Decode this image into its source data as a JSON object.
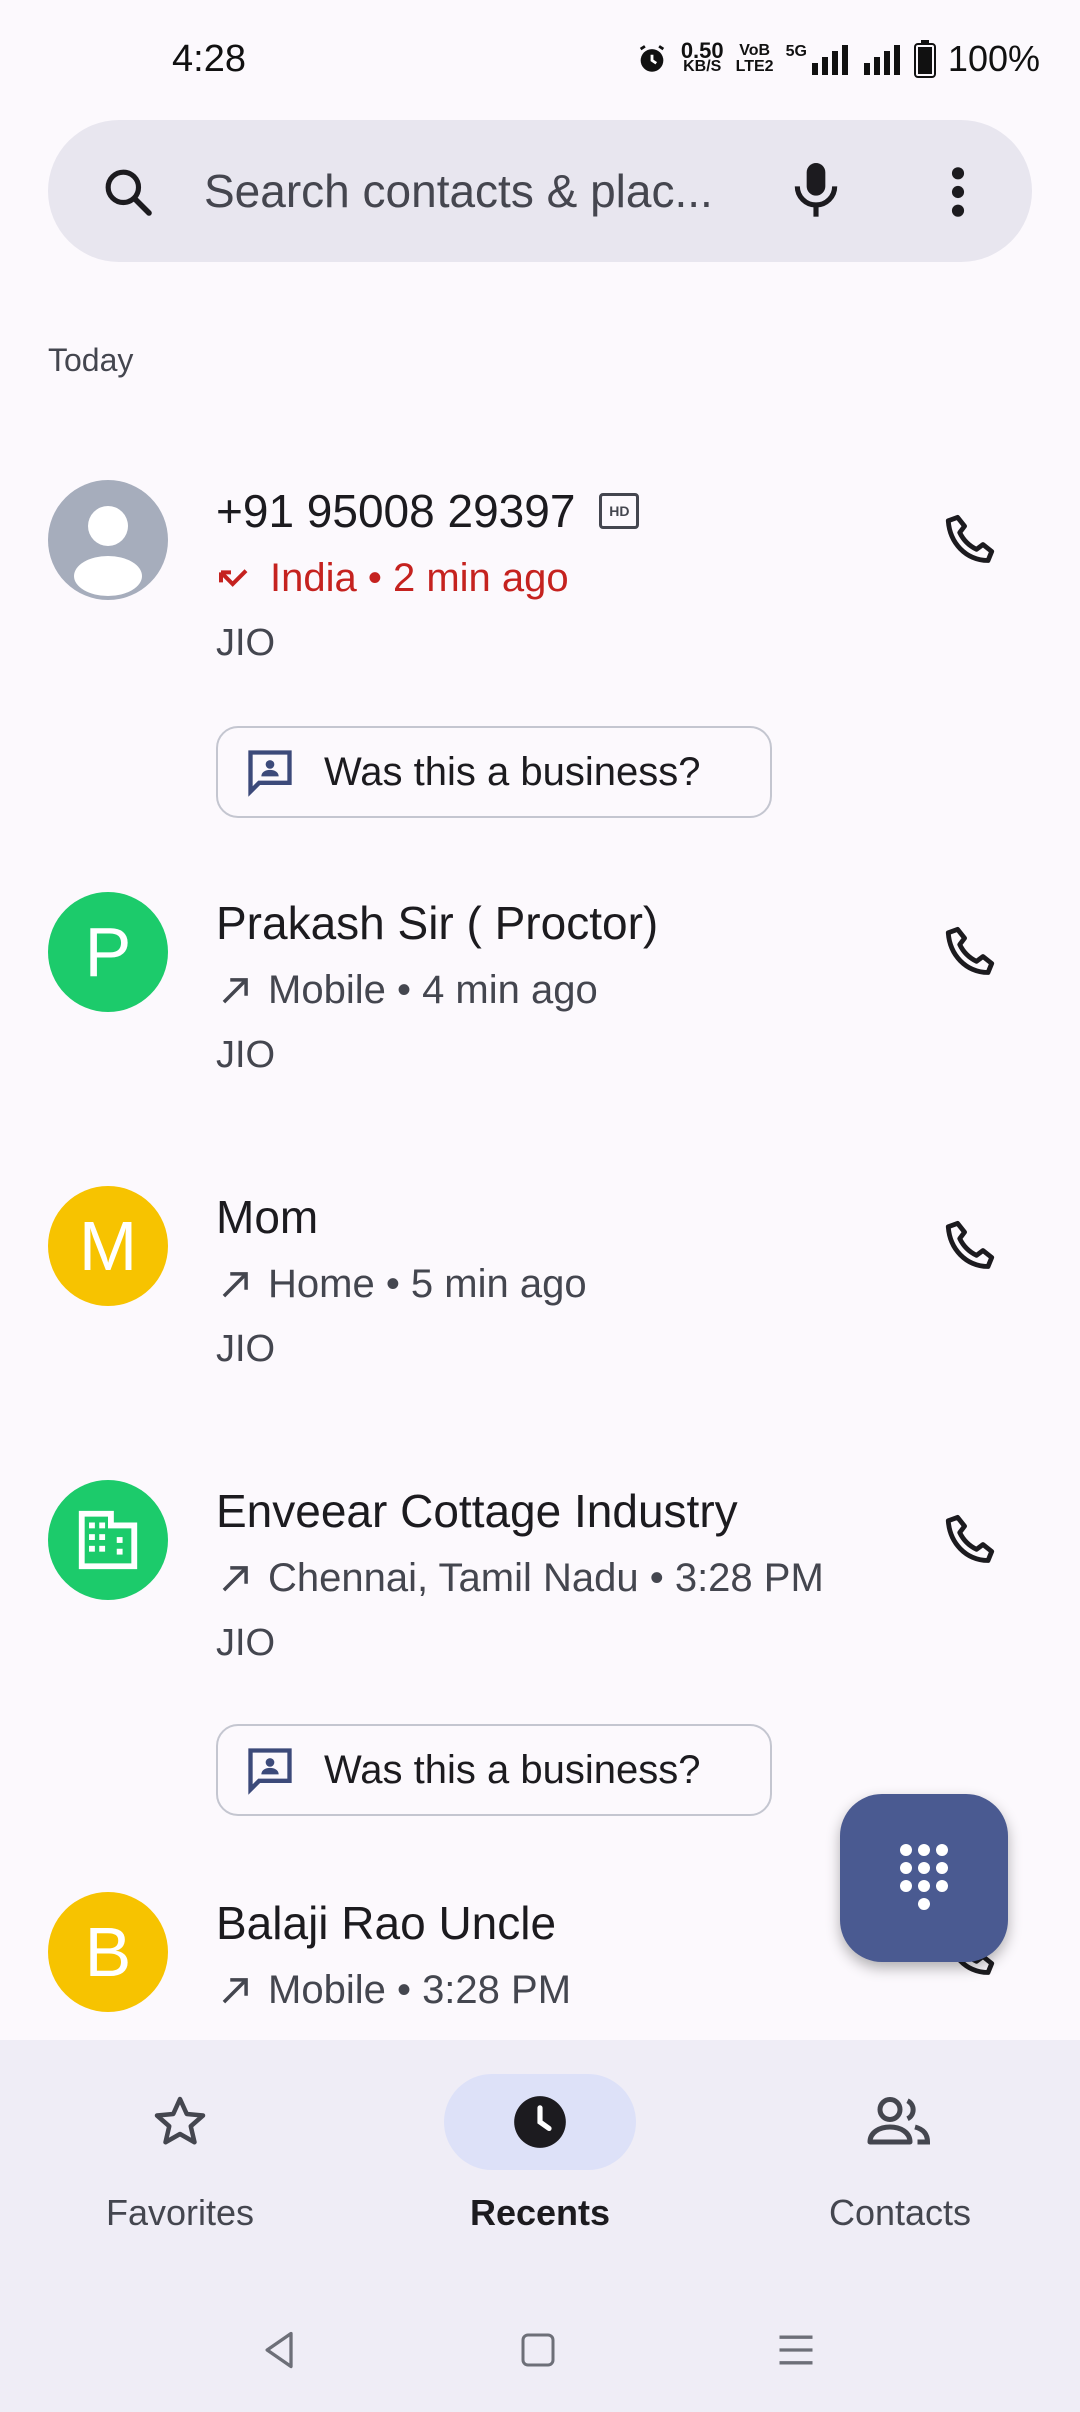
{
  "status_bar": {
    "time": "4:28",
    "net_speed_value": "0.50",
    "net_speed_unit": "KB/S",
    "volte_top": "VoB",
    "volte_bottom": "LTE2",
    "network": "5G",
    "battery": "100%"
  },
  "search": {
    "placeholder": "Search contacts & plac..."
  },
  "section_header": "Today",
  "calls": [
    {
      "name": "+91 95008 29397",
      "hd": "HD",
      "direction": "missed",
      "detail": "India • 2 min ago",
      "carrier": "JIO",
      "avatar_type": "person",
      "avatar_color": "#a6adbc",
      "business_prompt": "Was this a business?"
    },
    {
      "name": "Prakash Sir ( Proctor)",
      "direction": "outgoing",
      "detail": "Mobile • 4 min ago",
      "carrier": "JIO",
      "avatar_letter": "P",
      "avatar_color": "#1ccb6b"
    },
    {
      "name": "Mom",
      "direction": "outgoing",
      "detail": "Home • 5 min ago",
      "carrier": "JIO",
      "avatar_letter": "M",
      "avatar_color": "#f7c300"
    },
    {
      "name": "Enveear Cottage Industry",
      "direction": "outgoing",
      "detail": "Chennai, Tamil Nadu • 3:28 PM",
      "carrier": "JIO",
      "avatar_type": "business",
      "avatar_color": "#1ccb6b",
      "business_prompt": "Was this a business?"
    },
    {
      "name": "Balaji Rao Uncle",
      "direction": "outgoing",
      "detail": "Mobile • 3:28 PM",
      "avatar_letter": "B",
      "avatar_color": "#f7c300"
    }
  ],
  "bottom_nav": {
    "items": [
      {
        "label": "Favorites",
        "icon": "star-icon",
        "active": false
      },
      {
        "label": "Recents",
        "icon": "clock-icon",
        "active": true
      },
      {
        "label": "Contacts",
        "icon": "people-icon",
        "active": false
      }
    ]
  },
  "colors": {
    "missed": "#c5221f",
    "fab": "#4a5a91",
    "nav_active_pill": "#dde1f8"
  }
}
